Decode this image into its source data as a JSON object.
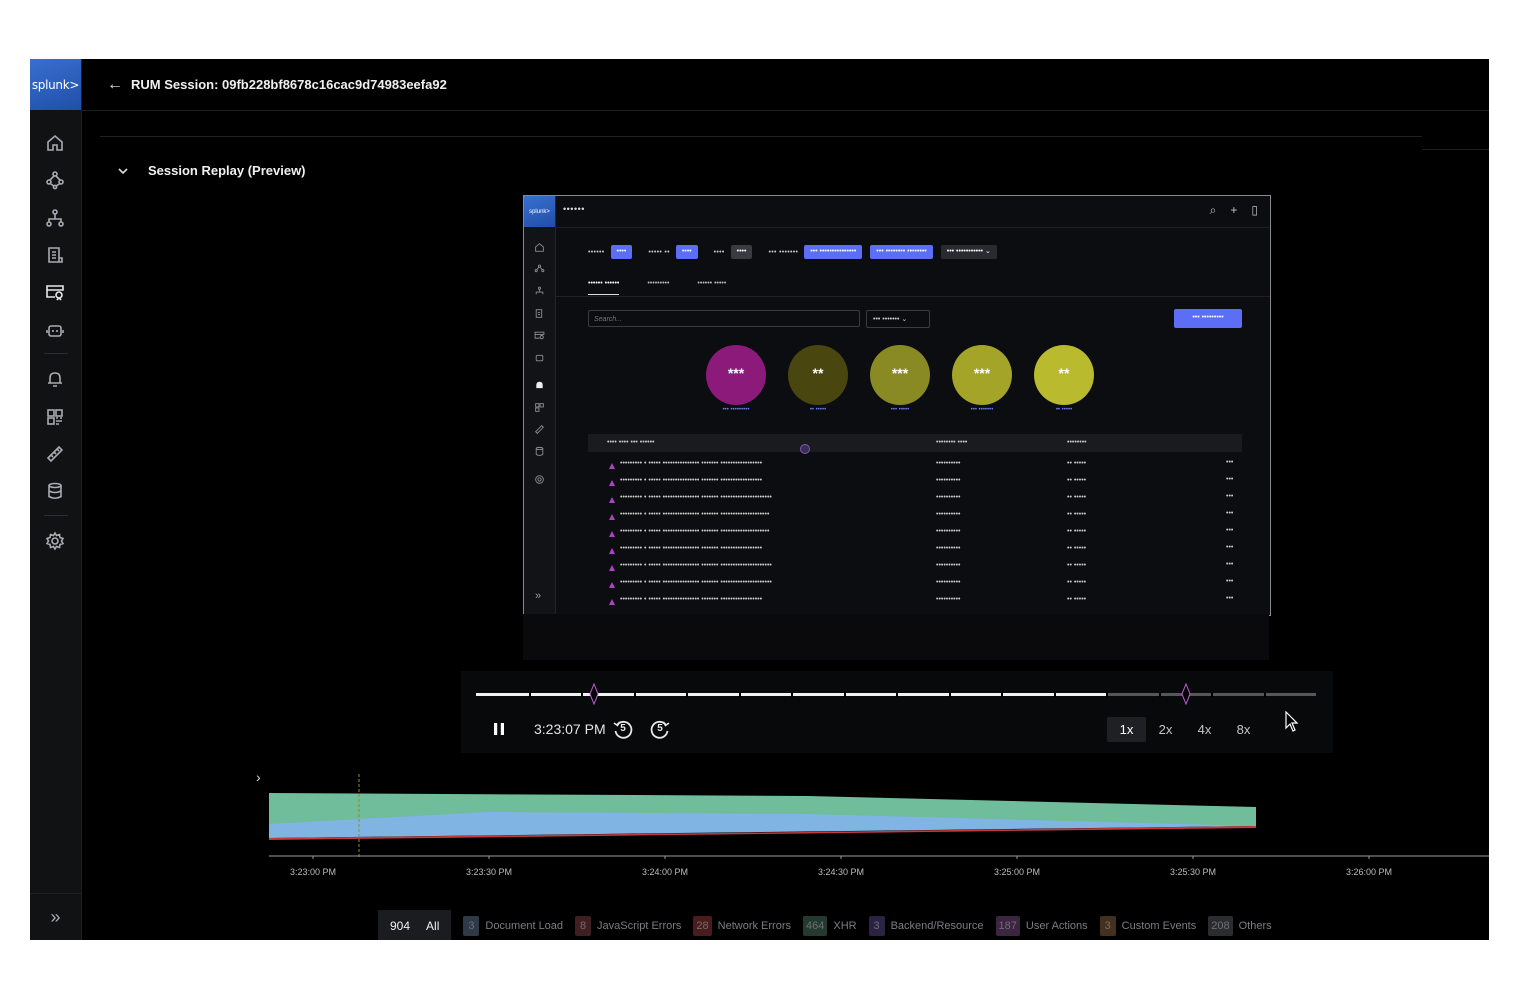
{
  "app": {
    "logo_text": "splunk>",
    "header_title": "RUM Session: 09fb228bf8678c16cac9d74983eefa92"
  },
  "nav": {
    "items": [
      "home-icon",
      "network-icon",
      "hierarchy-icon",
      "document-icon",
      "rum-icon",
      "robot-icon",
      "bell-icon",
      "dashboard-grid-icon",
      "ruler-icon",
      "database-icon",
      "gear-icon"
    ],
    "bottom": "»"
  },
  "section": {
    "title": "Session Replay (Preview)"
  },
  "replay": {
    "logo_text": "splunk>",
    "top_text": "••••••",
    "filters": [
      {
        "label": "••••••",
        "chip": "••••",
        "color": "#5b6ef5"
      },
      {
        "label": "••••• ••",
        "chip": "••••",
        "color": "#5b6ef5"
      },
      {
        "label": "••••",
        "chip": "••••",
        "color": "#3a3b40"
      },
      {
        "label": "••• •••••••",
        "chip": "••• •••••••••••••••",
        "color": "#5b6ef5"
      },
      {
        "label": "",
        "chip": "••• •••••••• ••••••••",
        "color": "#5b6ef5"
      },
      {
        "label": "",
        "chip": "••• ••••••••••• ⌄",
        "color": "#2a2b30"
      }
    ],
    "tabs": [
      "•••••• ••••••",
      "•••••••••",
      "•••••• •••••"
    ],
    "search_placeholder": "Search...",
    "select_label": "••• ••••••• ⌄",
    "button_label": "••• •••••••••",
    "circles": [
      {
        "text": "***",
        "label": "••• •••••••••",
        "color": "#8c1a7a"
      },
      {
        "text": "**",
        "label": "•• •••••",
        "color": "#4a4610"
      },
      {
        "text": "***",
        "label": "••• •••••",
        "color": "#8a8a25"
      },
      {
        "text": "***",
        "label": "••• •••••••",
        "color": "#a3a428"
      },
      {
        "text": "**",
        "label": "•• •••••",
        "color": "#b9ba2e"
      }
    ],
    "table_head": [
      "•••• •••• ••• ••••••",
      "•••••••• ••••",
      "••••••••"
    ],
    "rows": [
      {
        "c1": "••••••••• • ••••• ••••••••••••••• ••••••• •••••••••••••••••",
        "c2": "••••••••••",
        "c3": "•• •••••",
        "c4": "•••"
      },
      {
        "c1": "••••••••• • ••••• ••••••••••••••• ••••••• •••••••••••••••••",
        "c2": "••••••••••",
        "c3": "•• •••••",
        "c4": "•••"
      },
      {
        "c1": "••••••••• • ••••• ••••••••••••••• ••••••• •••••••••••••••••••••",
        "c2": "••••••••••",
        "c3": "•• •••••",
        "c4": "•••"
      },
      {
        "c1": "••••••••• • ••••• ••••••••••••••• ••••••• ••••••••••••••••••••",
        "c2": "••••••••••",
        "c3": "•• •••••",
        "c4": "•••"
      },
      {
        "c1": "••••••••• • ••••• ••••••••••••••• ••••••• ••••••••••••••••••••",
        "c2": "••••••••••",
        "c3": "•• •••••",
        "c4": "•••"
      },
      {
        "c1": "••••••••• • ••••• ••••••••••••••• ••••••• •••••••••••••••••",
        "c2": "••••••••••",
        "c3": "•• •••••",
        "c4": "•••"
      },
      {
        "c1": "••••••••• • ••••• ••••••••••••••• ••••••• •••••••••••••••••••••",
        "c2": "••••••••••",
        "c3": "•• •••••",
        "c4": "•••"
      },
      {
        "c1": "••••••••• • ••••• ••••••••••••••• ••••••• •••••••••••••••••••••",
        "c2": "••••••••••",
        "c3": "•• •••••",
        "c4": "•••"
      },
      {
        "c1": "••••••••• • ••••• ••••••••••••••• ••••••• •••••••••••••••••",
        "c2": "••••••••••",
        "c3": "•• •••••",
        "c4": "•••"
      }
    ]
  },
  "player": {
    "time": "3:23:07 PM",
    "skip_back": "5",
    "skip_forward": "5",
    "progress": 0.75,
    "segments": 16,
    "markers": [
      0.14,
      0.845
    ],
    "speeds": [
      "1x",
      "2x",
      "4x",
      "8x"
    ],
    "active_speed": "1x"
  },
  "timeline": {
    "x_labels": [
      "3:23:00 PM",
      "3:23:30 PM",
      "3:24:00 PM",
      "3:24:30 PM",
      "3:25:00 PM",
      "3:25:30 PM",
      "3:26:00 PM"
    ],
    "colors": {
      "green": "#6fbd9a",
      "blue": "#7fb4e3",
      "red": "#d23a3a"
    }
  },
  "legend": {
    "total": "904",
    "all_label": "All",
    "items": [
      {
        "count": "3",
        "label": "Document Load",
        "color": "#2f3a46"
      },
      {
        "count": "8",
        "label": "JavaScript Errors",
        "color": "#3f1f1f"
      },
      {
        "count": "28",
        "label": "Network Errors",
        "color": "#4a1c1c"
      },
      {
        "count": "464",
        "label": "XHR",
        "color": "#243a30"
      },
      {
        "count": "3",
        "label": "Backend/Resource",
        "color": "#2c2344"
      },
      {
        "count": "187",
        "label": "User Actions",
        "color": "#3b2540"
      },
      {
        "count": "3",
        "label": "Custom Events",
        "color": "#45301f"
      },
      {
        "count": "208",
        "label": "Others",
        "color": "#2b2c30"
      }
    ]
  }
}
